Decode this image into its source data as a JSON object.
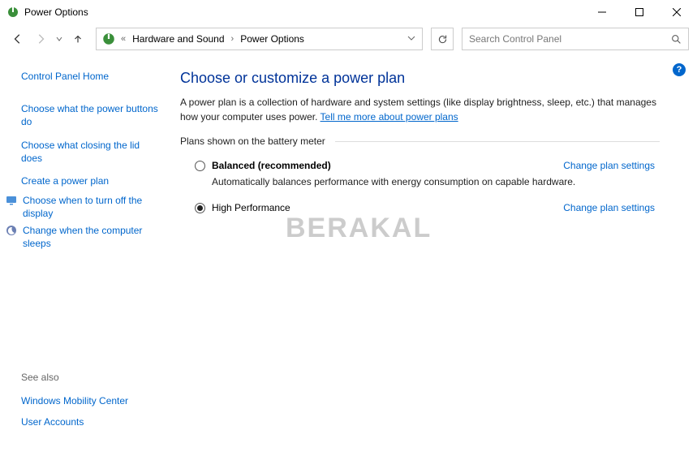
{
  "titlebar": {
    "title": "Power Options"
  },
  "breadcrumb": {
    "seg1": "Hardware and Sound",
    "seg2": "Power Options",
    "chev": "«"
  },
  "search": {
    "placeholder": "Search Control Panel"
  },
  "sidebar": {
    "home": "Control Panel Home",
    "links": [
      "Choose what the power buttons do",
      "Choose what closing the lid does",
      "Create a power plan",
      "Choose when to turn off the display",
      "Change when the computer sleeps"
    ],
    "seealso_label": "See also",
    "seealso": [
      "Windows Mobility Center",
      "User Accounts"
    ]
  },
  "main": {
    "heading": "Choose or customize a power plan",
    "desc_a": "A power plan is a collection of hardware and system settings (like display brightness, sleep, etc.) that manages how your computer uses power. ",
    "desc_link": "Tell me more about power plans",
    "group_label": "Plans shown on the battery meter",
    "plans": [
      {
        "name": "Balanced (recommended)",
        "sub": "Automatically balances performance with energy consumption on capable hardware.",
        "change": "Change plan settings",
        "selected": false
      },
      {
        "name": "High Performance",
        "sub": "",
        "change": "Change plan settings",
        "selected": true
      }
    ]
  },
  "watermark": "BERAKAL",
  "help": "?"
}
